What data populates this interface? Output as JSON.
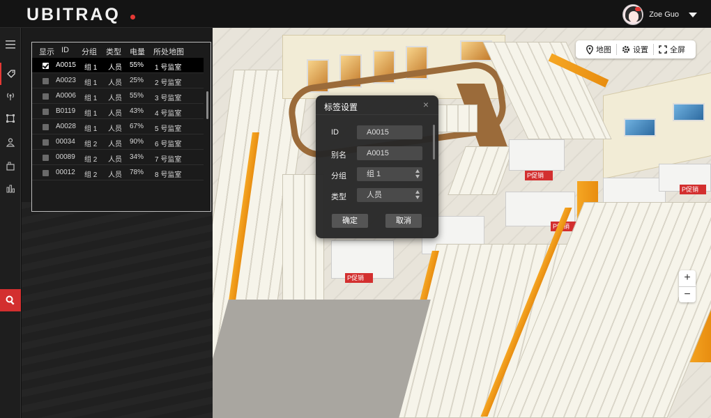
{
  "app": {
    "logo": "UBITRAQ"
  },
  "user": {
    "name": "Zoe Guo"
  },
  "tag_table": {
    "headers": [
      "显示",
      "ID",
      "分组",
      "类型",
      "电量",
      "所处地图"
    ],
    "rows": [
      {
        "id": "A0015",
        "group": "组 1",
        "type": "人员",
        "battery": "55%",
        "map": "1 号监室",
        "checked": true
      },
      {
        "id": "A0023",
        "group": "组 1",
        "type": "人员",
        "battery": "25%",
        "map": "2 号监室",
        "checked": false
      },
      {
        "id": "A0006",
        "group": "组 1",
        "type": "人员",
        "battery": "55%",
        "map": "3 号监室",
        "checked": false
      },
      {
        "id": "B0119",
        "group": "组 1",
        "type": "人员",
        "battery": "43%",
        "map": "4 号监室",
        "checked": false
      },
      {
        "id": "A0028",
        "group": "组 1",
        "type": "人员",
        "battery": "67%",
        "map": "5 号监室",
        "checked": false
      },
      {
        "id": "00034",
        "group": "组 2",
        "type": "人员",
        "battery": "90%",
        "map": "6 号监室",
        "checked": false
      },
      {
        "id": "00089",
        "group": "组 2",
        "type": "人员",
        "battery": "34%",
        "map": "7 号监室",
        "checked": false
      },
      {
        "id": "00012",
        "group": "组 2",
        "type": "人员",
        "battery": "78%",
        "map": "8 号监室",
        "checked": false
      }
    ]
  },
  "map_tools": {
    "map": "地图",
    "settings": "设置",
    "fullscreen": "全屏"
  },
  "zoom": {
    "in": "+",
    "out": "−"
  },
  "map_labels": {
    "promo": "P促销"
  },
  "dialog": {
    "title": "标签设置",
    "close": "×",
    "fields": {
      "id_label": "ID",
      "id_value": "A0015",
      "alias_label": "别名",
      "alias_value": "A0015",
      "group_label": "分组",
      "group_value": "组 1",
      "type_label": "类型",
      "type_value": "人员"
    },
    "confirm": "确定",
    "cancel": "取消"
  },
  "colors": {
    "accent": "#d32f2f",
    "topbar": "#141414",
    "panel": "#1c1c1c"
  },
  "icons": {
    "rail": [
      "menu-icon",
      "tag-icon",
      "antenna-icon",
      "area-icon",
      "person-icon",
      "device-icon",
      "chart-icon",
      "search-icon"
    ]
  }
}
